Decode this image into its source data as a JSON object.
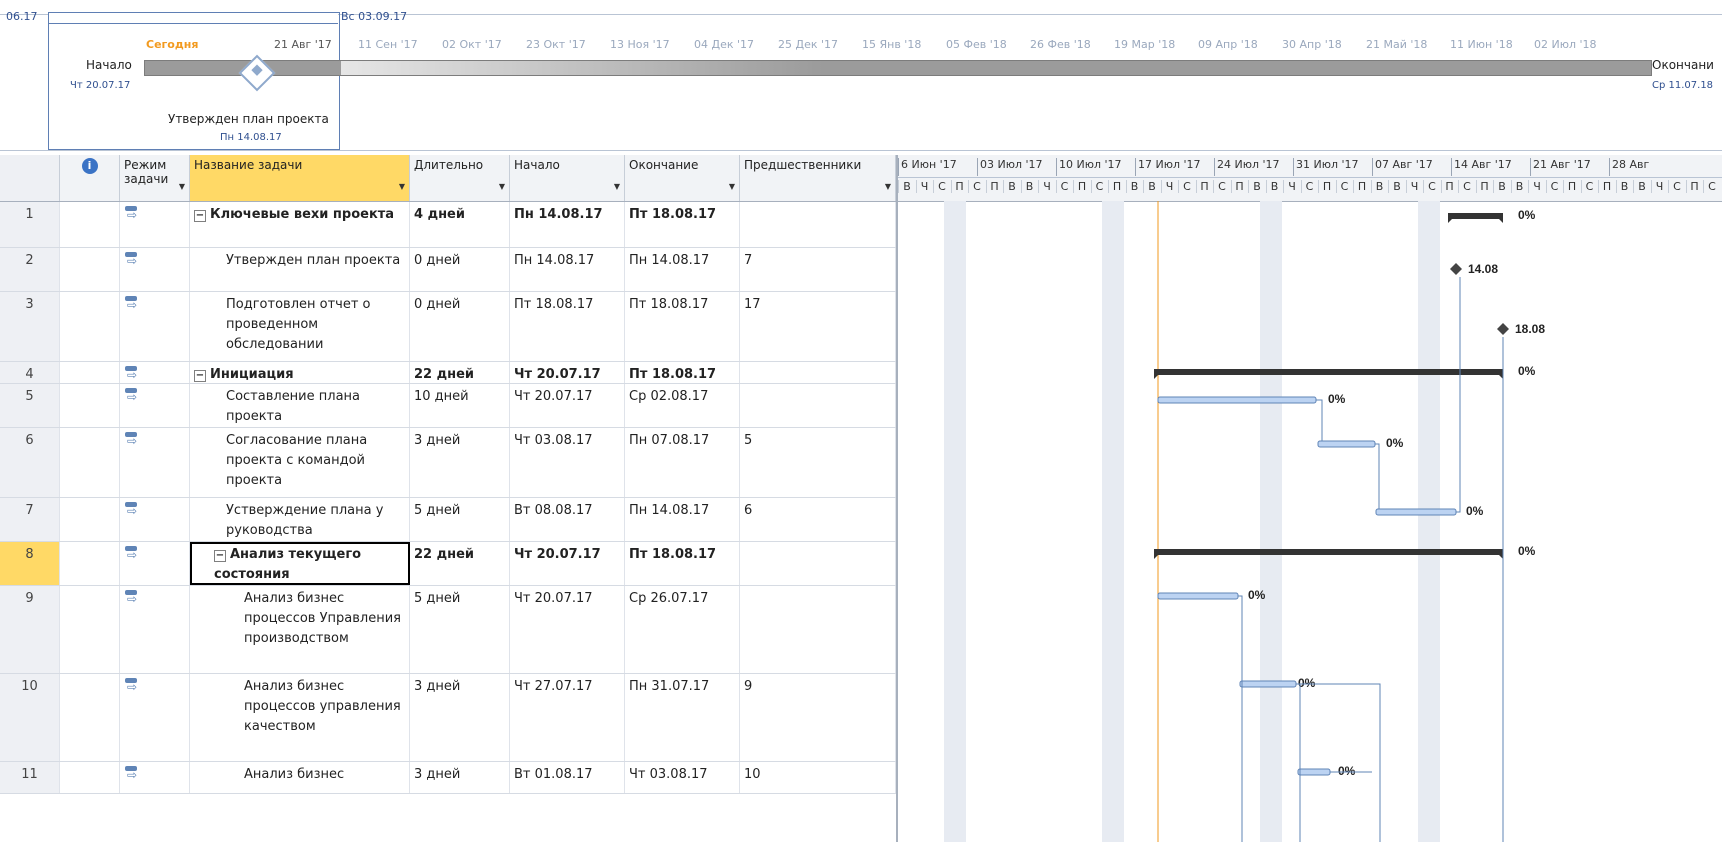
{
  "timeline": {
    "left_date": "06.17",
    "range_end": "Вс 03.09.17",
    "today": "Сегодня",
    "scale_labels": [
      "21 Авг '17",
      "11 Сен '17",
      "02 Окт '17",
      "23 Окт '17",
      "13 Ноя '17",
      "04 Дек '17",
      "25 Дек '17",
      "15 Янв '18",
      "05 Фев '18",
      "26 Фев '18",
      "19 Мар '18",
      "09 Апр '18",
      "30 Апр '18",
      "21 Май '18",
      "11 Июн '18",
      "02 Июл '18"
    ],
    "start_label": "Начало",
    "start_date": "Чт 20.07.17",
    "end_label": "Окончани",
    "end_date": "Ср 11.07.18",
    "milestone_label": "Утвержден план проекта",
    "milestone_date": "Пн 14.08.17"
  },
  "grid": {
    "headers": {
      "id": "",
      "info": "i",
      "mode": "Режим задачи",
      "name": "Название задачи",
      "duration": "Длительно",
      "start": "Начало",
      "finish": "Окончание",
      "pred": "Предшественники"
    },
    "rows": [
      {
        "id": "1",
        "name": "Ключевые вехи проекта",
        "duration": "4 дней",
        "start": "Пн 14.08.17",
        "finish": "Пт 18.08.17",
        "pred": "",
        "summary": true
      },
      {
        "id": "2",
        "name": "Утвержден план проекта",
        "duration": "0 дней",
        "start": "Пн 14.08.17",
        "finish": "Пн 14.08.17",
        "pred": "7",
        "summary": false
      },
      {
        "id": "3",
        "name": "Подготовлен отчет о проведенном обследовании",
        "duration": "0 дней",
        "start": "Пт 18.08.17",
        "finish": "Пт 18.08.17",
        "pred": "17",
        "summary": false
      },
      {
        "id": "4",
        "name": "Инициация",
        "duration": "22 дней",
        "start": "Чт 20.07.17",
        "finish": "Пт 18.08.17",
        "pred": "",
        "summary": true
      },
      {
        "id": "5",
        "name": "Составление плана проекта",
        "duration": "10 дней",
        "start": "Чт 20.07.17",
        "finish": "Ср 02.08.17",
        "pred": "",
        "summary": false
      },
      {
        "id": "6",
        "name": "Согласование плана проекта с командой проекта",
        "duration": "3 дней",
        "start": "Чт 03.08.17",
        "finish": "Пн 07.08.17",
        "pred": "5",
        "summary": false
      },
      {
        "id": "7",
        "name": "Устверждение плана у руководства",
        "duration": "5 дней",
        "start": "Вт 08.08.17",
        "finish": "Пн 14.08.17",
        "pred": "6",
        "summary": false
      },
      {
        "id": "8",
        "name": "Анализ текущего состояния",
        "duration": "22 дней",
        "start": "Чт 20.07.17",
        "finish": "Пт 18.08.17",
        "pred": "",
        "summary": true
      },
      {
        "id": "9",
        "name": "Анализ бизнес процессов Управления производством",
        "duration": "5 дней",
        "start": "Чт 20.07.17",
        "finish": "Ср 26.07.17",
        "pred": "",
        "summary": false
      },
      {
        "id": "10",
        "name": "Анализ бизнес процессов управления качеством",
        "duration": "3 дней",
        "start": "Чт 27.07.17",
        "finish": "Пн 31.07.17",
        "pred": "9",
        "summary": false
      },
      {
        "id": "11",
        "name": "Анализ бизнес",
        "duration": "3 дней",
        "start": "Вт 01.08.17",
        "finish": "Чт 03.08.17",
        "pred": "10",
        "summary": false
      }
    ]
  },
  "gantt": {
    "weeks": [
      "6 Июн '17",
      "03 Июл '17",
      "10 Июл '17",
      "17 Июл '17",
      "24 Июл '17",
      "31 Июл '17",
      "07 Авг '17",
      "14 Авг '17",
      "21 Авг '17",
      "28 Авг"
    ],
    "days": [
      "В",
      "Ч",
      "С",
      "П",
      "С",
      "П",
      "В",
      "В",
      "Ч",
      "С",
      "П",
      "С",
      "П",
      "В",
      "В",
      "Ч",
      "С",
      "П",
      "С",
      "П",
      "В",
      "В",
      "Ч",
      "С",
      "П",
      "С",
      "П",
      "В",
      "В",
      "Ч",
      "С",
      "П",
      "С",
      "П",
      "В",
      "В",
      "Ч",
      "С",
      "П",
      "С",
      "П",
      "В",
      "В",
      "Ч",
      "С",
      "П",
      "С"
    ],
    "pct": "0%",
    "ms1": "14.08",
    "ms2": "18.08"
  }
}
